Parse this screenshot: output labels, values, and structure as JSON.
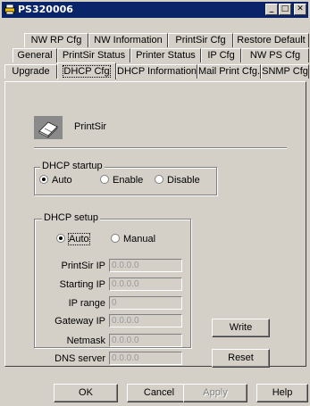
{
  "window": {
    "title": "PS320006",
    "buttons": {
      "minimize": "_",
      "maximize": "□",
      "close": "✕"
    }
  },
  "tabs": {
    "row1": [
      "NW RP Cfg",
      "NW Information",
      "PrintSir Cfg",
      "Restore Default"
    ],
    "row2": [
      "General",
      "PrintSir Status",
      "Printer Status",
      "IP Cfg",
      "NW PS Cfg"
    ],
    "row3": [
      "Upgrade",
      "DHCP Cfg",
      "DHCP Information",
      "Mail Print Cfg.",
      "SNMP Cfg"
    ],
    "active": "DHCP Cfg"
  },
  "brand": {
    "name": "PrintSir"
  },
  "dhcp_startup": {
    "legend": "DHCP startup",
    "options": [
      "Auto",
      "Enable",
      "Disable"
    ],
    "selected": "Auto"
  },
  "dhcp_setup": {
    "legend": "DHCP  setup",
    "options": [
      "Auto",
      "Manual"
    ],
    "selected": "Auto",
    "fields": [
      {
        "label": "PrintSir IP",
        "value": "0.0.0.0"
      },
      {
        "label": "Starting IP",
        "value": "0.0.0.0"
      },
      {
        "label": "IP range",
        "value": "0"
      },
      {
        "label": "Gateway IP",
        "value": "0.0.0.0"
      },
      {
        "label": "Netmask",
        "value": "0.0.0.0"
      },
      {
        "label": "DNS server",
        "value": "0.0.0.0"
      }
    ]
  },
  "actions": {
    "write": "Write",
    "reset": "Reset"
  },
  "footer": {
    "ok": "OK",
    "cancel": "Cancel",
    "apply": "Apply",
    "help": "Help"
  },
  "colors": {
    "titlebar": "#0a246a",
    "face": "#d4d0c8"
  }
}
